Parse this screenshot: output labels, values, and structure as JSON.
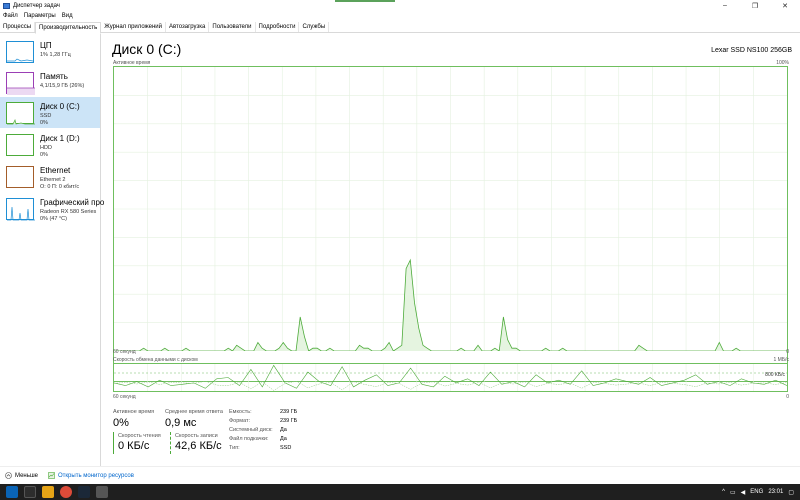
{
  "window": {
    "title": "Диспетчер задач",
    "minimize_glyph": "–",
    "maximize_glyph": "❐",
    "close_glyph": "✕"
  },
  "menu": [
    "Файл",
    "Параметры",
    "Вид"
  ],
  "tabs": [
    "Процессы",
    "Производительность",
    "Журнал приложений",
    "Автозагрузка",
    "Пользователи",
    "Подробности",
    "Службы"
  ],
  "active_tab_index": 1,
  "sidebar": {
    "items": [
      {
        "title": "ЦП",
        "sub1": "1% 1,28 ГГц",
        "sub2": "",
        "color": "#1f8fd5"
      },
      {
        "title": "Память",
        "sub1": "4,1/15,9 ГБ (26%)",
        "sub2": "",
        "color": "#9b3fb5"
      },
      {
        "title": "Диск 0 (C:)",
        "sub1": "SSD",
        "sub2": "0%",
        "color": "#4dab3a"
      },
      {
        "title": "Диск 1 (D:)",
        "sub1": "HDD",
        "sub2": "0%",
        "color": "#4dab3a"
      },
      {
        "title": "Ethernet",
        "sub1": "Ethernet 2",
        "sub2": "О: 0 П: 0 кбит/с",
        "color": "#a35d2a"
      },
      {
        "title": "Графический про",
        "sub1": "Radeon RX 580 Series",
        "sub2": "0% (47 °C)",
        "color": "#1f8fd5"
      }
    ],
    "selected_index": 2
  },
  "main": {
    "title": "Диск 0 (C:)",
    "model": "Lexar SSD NS100 256GB",
    "chart1_label": "Активное время",
    "chart1_max": "100%",
    "chart1_time_left": "60 секунд",
    "chart1_time_right": "0",
    "chart2_label": "Скорость обмена данными с диском",
    "chart2_max": "1 МБ/с",
    "chart2_mid": "800 КБ/с",
    "chart2_time_left": "60 секунд",
    "chart2_time_right": "0"
  },
  "stats": {
    "active_time_label": "Активное время",
    "active_time_value": "0%",
    "response_label": "Среднее время ответа",
    "response_value": "0,9 мс",
    "read_label": "Скорость чтения",
    "read_value": "0 КБ/с",
    "write_label": "Скорость записи",
    "write_value": "42,6 КБ/с",
    "capacity_label": "Емкость:",
    "capacity_value": "239 ГБ",
    "formatted_label": "Формат:",
    "formatted_value": "239 ГБ",
    "system_label": "Системный диск:",
    "system_value": "Да",
    "pagefile_label": "Файл подкачки:",
    "pagefile_value": "Да",
    "type_label": "Тип:",
    "type_value": "SSD"
  },
  "footer": {
    "less": "Меньше",
    "resource_monitor": "Открыть монитор ресурсов"
  },
  "taskbar": {
    "lang": "ENG",
    "time": "23:01"
  },
  "active_time_series": [
    0,
    0,
    0,
    0,
    0,
    0,
    0,
    1,
    0,
    0,
    0,
    0,
    1,
    0,
    0,
    0,
    0,
    1,
    0,
    0,
    0,
    0,
    0,
    0,
    0,
    0,
    0,
    1,
    0,
    2,
    1,
    0,
    0,
    0,
    3,
    1,
    0,
    0,
    0,
    1,
    3,
    1,
    0,
    0,
    12,
    5,
    0,
    1,
    1,
    0,
    0,
    1,
    0,
    0,
    0,
    0,
    0,
    0,
    2,
    1,
    1,
    0,
    0,
    0,
    1,
    3,
    0,
    1,
    2,
    29,
    32,
    17,
    8,
    2,
    1,
    0,
    0,
    0,
    0,
    0,
    0,
    0,
    1,
    0,
    0,
    0,
    2,
    0,
    0,
    0,
    1,
    0,
    12,
    4,
    1,
    1,
    0,
    0,
    0,
    0,
    0,
    0,
    1,
    0,
    0,
    0,
    1,
    0,
    0,
    0,
    0,
    0,
    0,
    0,
    0,
    0,
    0,
    0,
    0,
    0,
    0,
    0,
    0,
    0,
    2,
    1,
    0,
    0,
    0,
    0,
    0,
    0,
    0,
    0,
    0,
    0,
    0,
    0,
    0,
    0,
    0,
    0,
    0,
    3,
    0,
    0,
    0,
    1,
    0,
    0,
    0,
    0,
    0,
    0,
    0,
    0,
    0,
    0,
    0,
    0
  ],
  "transfer_series": [
    30,
    20,
    35,
    15,
    40,
    20,
    25,
    30,
    10,
    45,
    50,
    20,
    80,
    15,
    95,
    30,
    10,
    70,
    35,
    20,
    90,
    15,
    40,
    60,
    20,
    30,
    85,
    25,
    15,
    55,
    30,
    45,
    20,
    70,
    25,
    35,
    15,
    60,
    30,
    40,
    25,
    75,
    20,
    30,
    45,
    35,
    25,
    50,
    20,
    30,
    40,
    60,
    25,
    35,
    20,
    45,
    30,
    25,
    40,
    20
  ]
}
